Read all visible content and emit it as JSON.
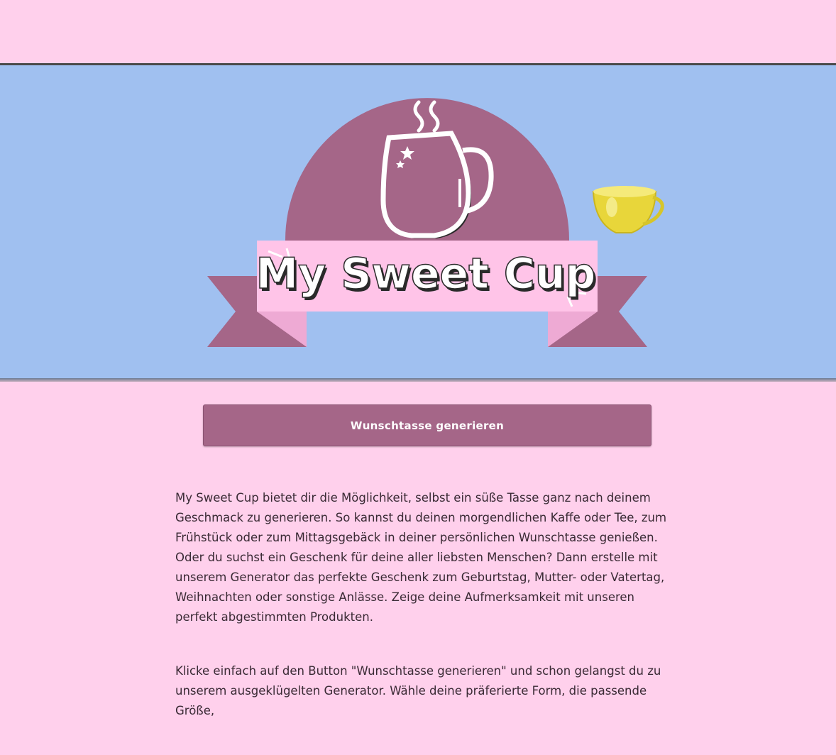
{
  "header": {
    "brand_color": "#ffd0ec"
  },
  "banner": {
    "background": "#a0c0f0",
    "logo": {
      "title": "My Sweet Cup",
      "icon": "mug-icon",
      "accent": "#a56688",
      "ribbon": "#ffc4e8"
    },
    "decoration": {
      "icon": "yellow-teacup-icon",
      "color": "#f2e34a"
    }
  },
  "cta": {
    "label": "Wunschtasse generieren"
  },
  "main": {
    "paragraphs": [
      "My Sweet Cup bietet dir die Möglichkeit, selbst ein süße Tasse ganz nach deinem Geschmack zu generieren. So kannst du deinen morgendlichen Kaffe oder Tee, zum Frühstück oder zum Mittagsgebäck in deiner persönlichen Wunschtasse genießen. Oder du suchst ein Geschenk für deine aller liebsten Menschen? Dann erstelle mit unserem Generator das perfekte Geschenk zum Geburtstag, Mutter- oder Vatertag, Weihnachten oder sonstige Anlässe. Zeige deine Aufmerksamkeit mit unseren perfekt abgestimmten Produkten.",
      "Klicke einfach auf den Button \"Wunschtasse generieren\" und schon gelangst du zu unserem ausgeklügelten Generator. Wähle deine präferierte Form, die passende Größe,"
    ]
  }
}
